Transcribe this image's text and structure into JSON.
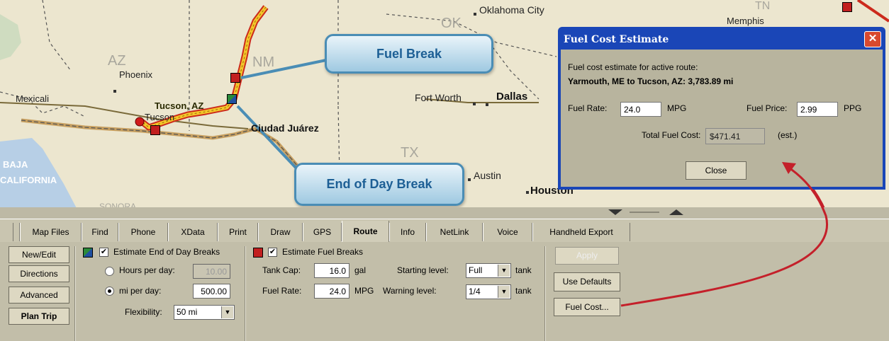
{
  "map": {
    "states": {
      "az": "AZ",
      "nm": "NM",
      "ok": "OK",
      "tx": "TX",
      "tn": "TN"
    },
    "cities": {
      "phoenix": "Phoenix",
      "mexicali": "Mexicali",
      "tucson": "Tucson",
      "tucson_az": "Tucson, AZ",
      "fort_worth": "Fort Worth",
      "dallas": "Dallas",
      "ciudad_juarez": "Ciudad Juárez",
      "oklahoma_city": "Oklahoma City",
      "memphis": "Memphis",
      "austin": "Austin",
      "houston": "Houston",
      "baja": "BAJA",
      "california": "CALIFORNIA",
      "sonora": "SONORA"
    },
    "callouts": {
      "fuel_break": "Fuel Break",
      "end_of_day_break": "End of Day Break"
    },
    "colors": {
      "route": "#f3c82a",
      "route_outline": "#cc2a1c",
      "callout_border": "#4a8db5",
      "annotation_arrow": "#c4202a"
    }
  },
  "dialog": {
    "title": "Fuel Cost Estimate",
    "close_glyph": "✕",
    "intro": "Fuel cost estimate for active route:",
    "route_summary": "Yarmouth, ME to Tucson, AZ: 3,783.89 mi",
    "fuel_rate_label": "Fuel Rate:",
    "fuel_rate_value": "24.0",
    "fuel_rate_unit": "MPG",
    "fuel_price_label": "Fuel Price:",
    "fuel_price_value": "2.99",
    "fuel_price_unit": "PPG",
    "total_label": "Total Fuel Cost:",
    "total_value": "$471.41",
    "total_suffix": "(est.)",
    "close_button": "Close"
  },
  "tabs": [
    "Map Files",
    "Find",
    "Phone",
    "XData",
    "Print",
    "Draw",
    "GPS",
    "Route",
    "Info",
    "NetLink",
    "Voice",
    "Handheld Export"
  ],
  "active_tab": "Route",
  "left_buttons": {
    "new_edit": "New/Edit",
    "directions": "Directions",
    "advanced": "Advanced",
    "plan_trip": "Plan Trip"
  },
  "end_of_day": {
    "checkbox_label": "Estimate End of Day Breaks",
    "checked": true,
    "hours_label": "Hours per day:",
    "hours_value": "10.00",
    "mi_label": "mi per day:",
    "mi_value": "500.00",
    "selected_mode": "mi per day",
    "flexibility_label": "Flexibility:",
    "flexibility_value": "50 mi"
  },
  "fuel_breaks": {
    "checkbox_label": "Estimate Fuel Breaks",
    "checked": true,
    "tank_cap_label": "Tank Cap:",
    "tank_cap_value": "16.0",
    "tank_cap_unit": "gal",
    "fuel_rate_label": "Fuel Rate:",
    "fuel_rate_value": "24.0",
    "fuel_rate_unit": "MPG",
    "starting_level_label": "Starting level:",
    "starting_level_value": "Full",
    "warning_level_label": "Warning level:",
    "warning_level_value": "1/4",
    "tank_unit": "tank"
  },
  "right_buttons": {
    "apply": "Apply",
    "use_defaults": "Use Defaults",
    "fuel_cost": "Fuel Cost..."
  }
}
